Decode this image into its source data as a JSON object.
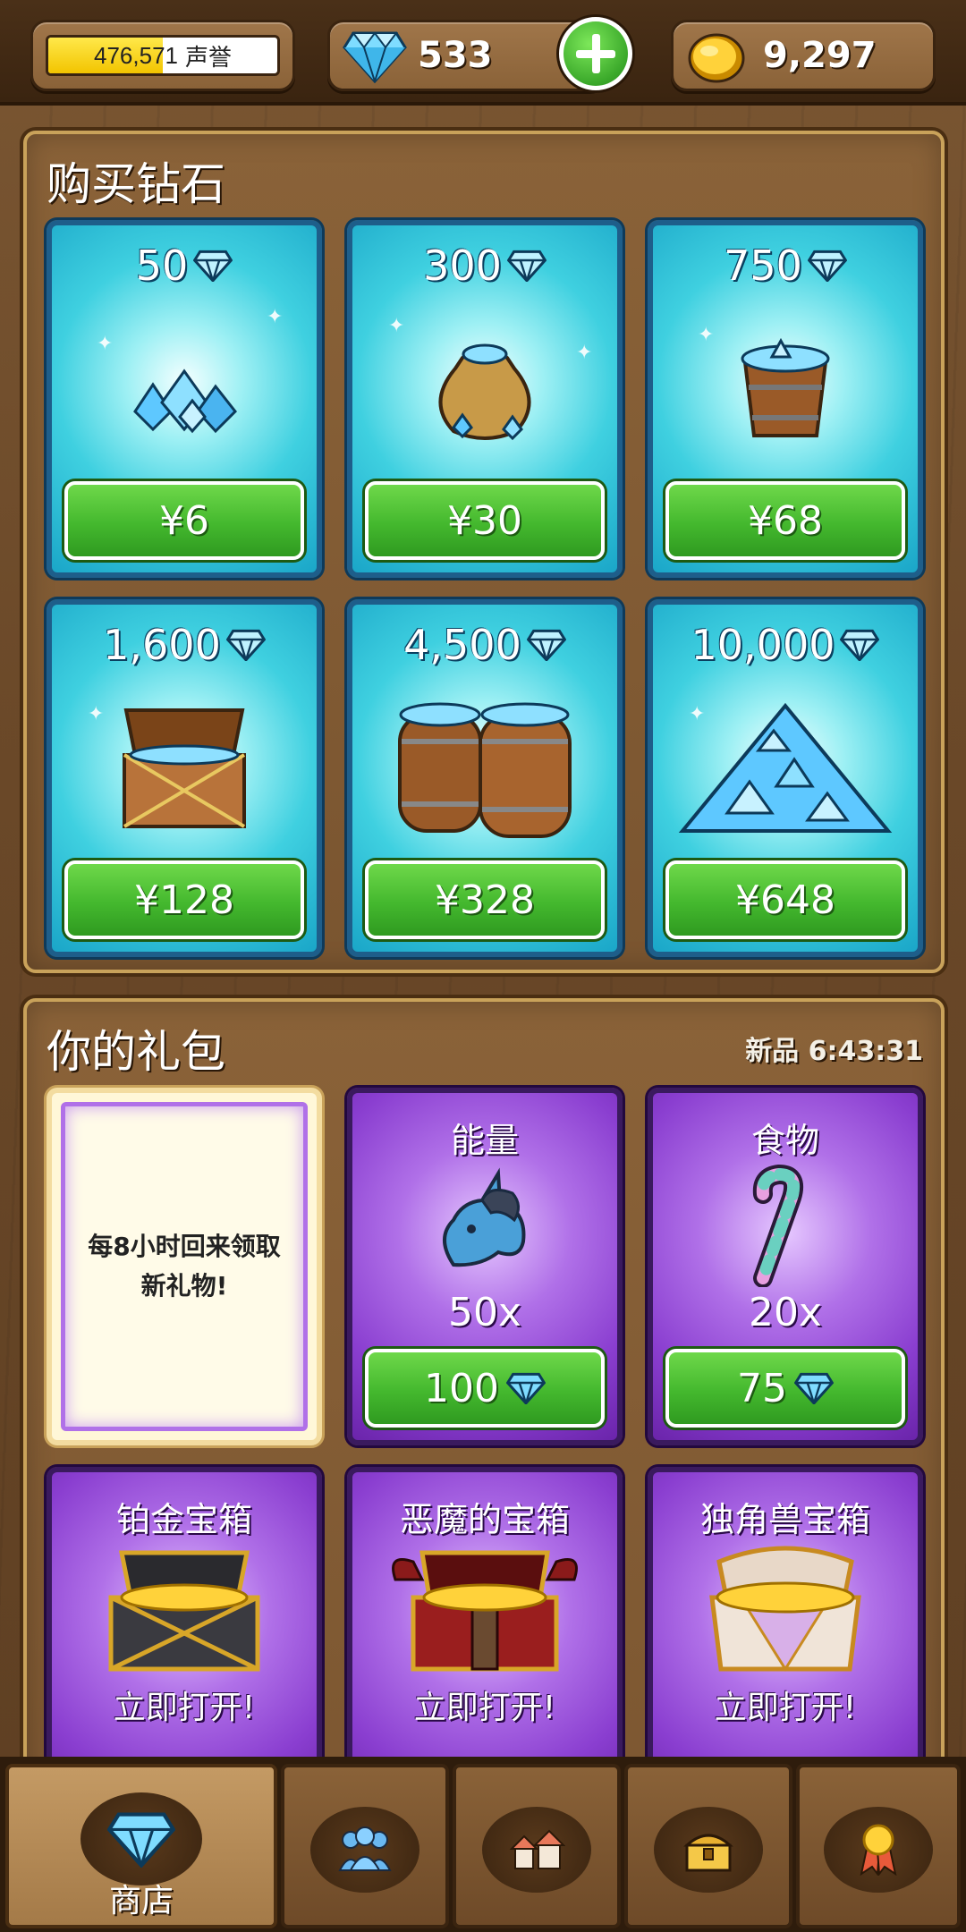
{
  "topbar": {
    "reputation_value": "476,571",
    "reputation_label": "声誉",
    "reputation_progress": 0.5,
    "gems": "533",
    "gold": "9,297"
  },
  "shop": {
    "title": "购买钻石",
    "packs": [
      {
        "amount": "50",
        "price": "¥6",
        "icon": "gem-pile"
      },
      {
        "amount": "300",
        "price": "¥30",
        "icon": "gem-bag"
      },
      {
        "amount": "750",
        "price": "¥68",
        "icon": "gem-bucket"
      },
      {
        "amount": "1,600",
        "price": "¥128",
        "icon": "gem-chest"
      },
      {
        "amount": "4,500",
        "price": "¥328",
        "icon": "gem-barrels"
      },
      {
        "amount": "10,000",
        "price": "¥648",
        "icon": "gem-mountain"
      }
    ]
  },
  "gifts": {
    "title": "你的礼包",
    "timer": "新品 6:43:31",
    "note": "每8小时回来领取新礼物!",
    "items": [
      {
        "label": "能量",
        "qty": "50x",
        "price": "100",
        "icon": "unicorn-icon"
      },
      {
        "label": "食物",
        "qty": "20x",
        "price": "75",
        "icon": "candy-cane-icon"
      }
    ],
    "chests": [
      {
        "label": "铂金宝箱",
        "action": "立即打开!"
      },
      {
        "label": "恶魔的宝箱",
        "action": "立即打开!"
      },
      {
        "label": "独角兽宝箱",
        "action": "立即打开!"
      }
    ]
  },
  "nav": {
    "tabs": [
      {
        "label": "商店",
        "icon": "gem-icon",
        "active": true
      },
      {
        "label": "",
        "icon": "people-icon"
      },
      {
        "label": "",
        "icon": "houses-icon"
      },
      {
        "label": "",
        "icon": "chest-icon"
      },
      {
        "label": "",
        "icon": "medal-icon"
      }
    ]
  },
  "colors": {
    "gem_card": "#3fd0e0",
    "gift_card": "#8a3ed0",
    "buy_button": "#44b82e",
    "wood": "#7a5530"
  }
}
